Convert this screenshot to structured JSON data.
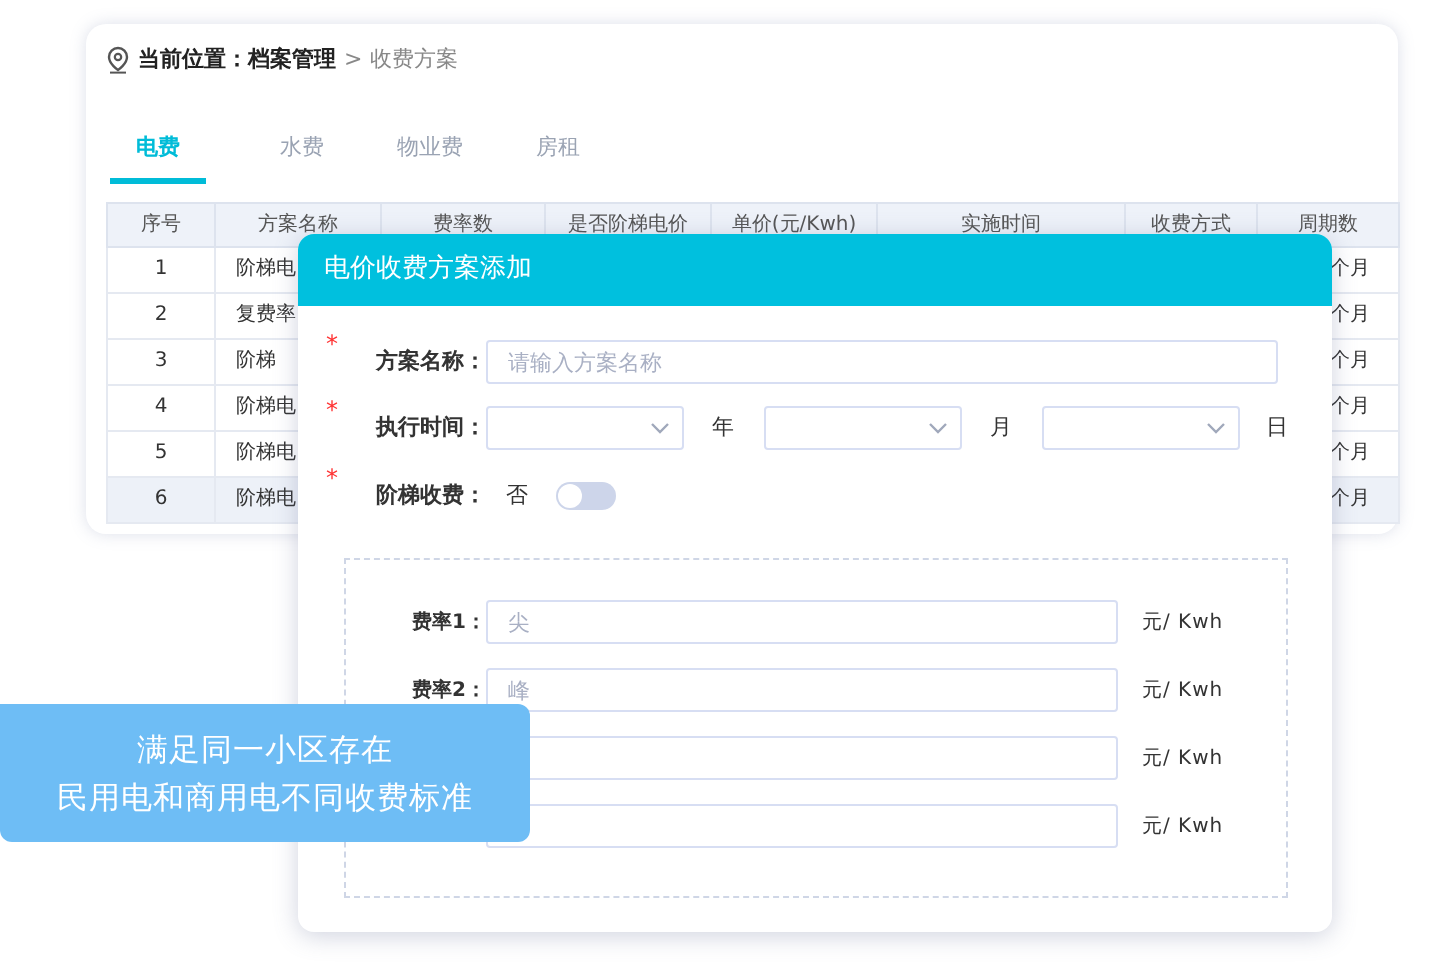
{
  "breadcrumb": {
    "label": "当前位置：",
    "path": "档案管理",
    "separator": ">",
    "current": "收费方案"
  },
  "tabs": [
    {
      "label": "电费",
      "selected": true
    },
    {
      "label": "水费",
      "selected": false
    },
    {
      "label": "物业费",
      "selected": false
    },
    {
      "label": "房租",
      "selected": false
    }
  ],
  "table": {
    "columns": [
      "序号",
      "方案名称",
      "费率数",
      "是否阶梯电价",
      "单价(元/Kwh)",
      "实施时间",
      "收费方式",
      "周期数"
    ],
    "rows": [
      {
        "index": "1",
        "name": "阶梯电",
        "period": "个月",
        "selected": false
      },
      {
        "index": "2",
        "name": "复费率",
        "period": "个月",
        "selected": false
      },
      {
        "index": "3",
        "name": "阶梯",
        "period": "个月",
        "selected": false
      },
      {
        "index": "4",
        "name": "阶梯电",
        "period": "个月",
        "selected": false
      },
      {
        "index": "5",
        "name": "阶梯电",
        "period": "个月",
        "selected": false
      },
      {
        "index": "6",
        "name": "阶梯电",
        "period": "个月",
        "selected": true
      }
    ]
  },
  "dialog": {
    "title": "电价收费方案添加",
    "name_field": {
      "mark": "*",
      "label": "方案名称：",
      "placeholder": "请输入方案名称"
    },
    "date_field": {
      "mark": "*",
      "label": "执行时间：",
      "units": [
        "年",
        "月",
        "日"
      ]
    },
    "tier_field": {
      "mark": "*",
      "label": "阶梯收费：",
      "state_text": "否",
      "on": false
    },
    "rates": [
      {
        "label": "费率1：",
        "placeholder": "尖",
        "unit": "元/ Kwh"
      },
      {
        "label": "费率2：",
        "placeholder": "峰",
        "unit": "元/ Kwh"
      },
      {
        "unit": "元/ Kwh"
      },
      {
        "unit": "元/ Kwh"
      }
    ]
  },
  "callout": {
    "lines": [
      "满足同一小区存在",
      "民用电和商用电不同收费标准"
    ]
  }
}
